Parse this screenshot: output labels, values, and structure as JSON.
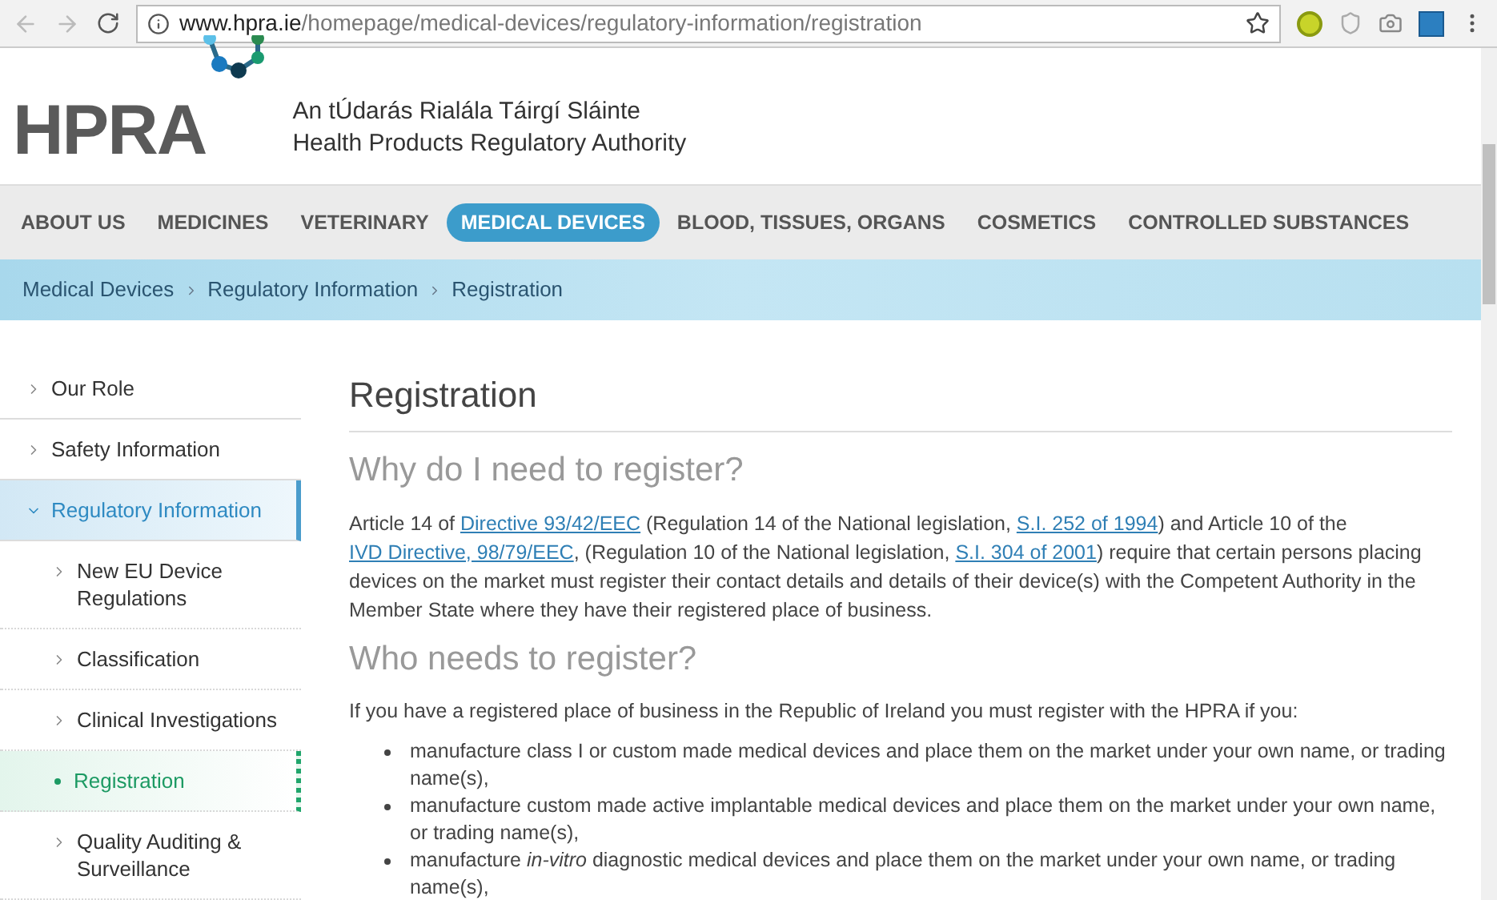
{
  "browser": {
    "url_host": "www.hpra.ie",
    "url_path": "/homepage/medical-devices/regulatory-information/registration"
  },
  "header": {
    "logo": "HPRA",
    "title_irish": "An tÚdarás Rialála Táirgí Sláinte",
    "title_english": "Health Products Regulatory Authority"
  },
  "nav": [
    {
      "label": "ABOUT US",
      "selected": false
    },
    {
      "label": "MEDICINES",
      "selected": false
    },
    {
      "label": "VETERINARY",
      "selected": false
    },
    {
      "label": "MEDICAL DEVICES",
      "selected": true
    },
    {
      "label": "BLOOD, TISSUES, ORGANS",
      "selected": false
    },
    {
      "label": "COSMETICS",
      "selected": false
    },
    {
      "label": "CONTROLLED SUBSTANCES",
      "selected": false
    }
  ],
  "breadcrumb": [
    "Medical Devices",
    "Regulatory Information",
    "Registration"
  ],
  "sidebar": [
    {
      "label": "Our Role",
      "expanded": false,
      "selected": false
    },
    {
      "label": "Safety Information",
      "expanded": false,
      "selected": false
    },
    {
      "label": "Regulatory Information",
      "expanded": true,
      "selected": false,
      "children": [
        {
          "label": "New EU Device Regulations",
          "selected": false
        },
        {
          "label": "Classification",
          "selected": false
        },
        {
          "label": "Clinical Investigations",
          "selected": false
        },
        {
          "label": "Registration",
          "selected": true
        },
        {
          "label": "Quality Auditing & Surveillance",
          "selected": false
        }
      ]
    }
  ],
  "content": {
    "title": "Registration",
    "heading_1": "Why do I need to register?",
    "paragraph_1": [
      {
        "kind": "text",
        "text": "Article 14 of "
      },
      {
        "kind": "link",
        "text": "Directive 93/42/EEC"
      },
      {
        "kind": "text",
        "text": " (Regulation 14 of the National legislation,  "
      },
      {
        "kind": "link",
        "text": "S.I. 252 of 1994"
      },
      {
        "kind": "text",
        "text": ") and Article 10 of the "
      },
      {
        "kind": "link",
        "text": "IVD Directive, 98/79/EEC"
      },
      {
        "kind": "text",
        "text": ", (Regulation 10 of the National legislation, "
      },
      {
        "kind": "link",
        "text": "S.I. 304 of 2001"
      },
      {
        "kind": "text",
        "text": ") require that certain persons placing devices on the market must register their contact details and details of their device(s) with the Competent Authority in the Member State where they have their registered place of business."
      }
    ],
    "heading_2": "Who needs to register?",
    "paragraph_2": "If you have a registered place of business in the Republic of Ireland you must register with the HPRA if you:",
    "bullets": [
      "manufacture class I or custom made medical devices and place them on the market under your own name, or trading name(s),",
      "manufacture custom made active implantable medical devices and place them on the market under your own name, or trading name(s),",
      "manufacture *in-vitro* diagnostic medical devices and place them on the market under your own name, or trading name(s),"
    ]
  }
}
